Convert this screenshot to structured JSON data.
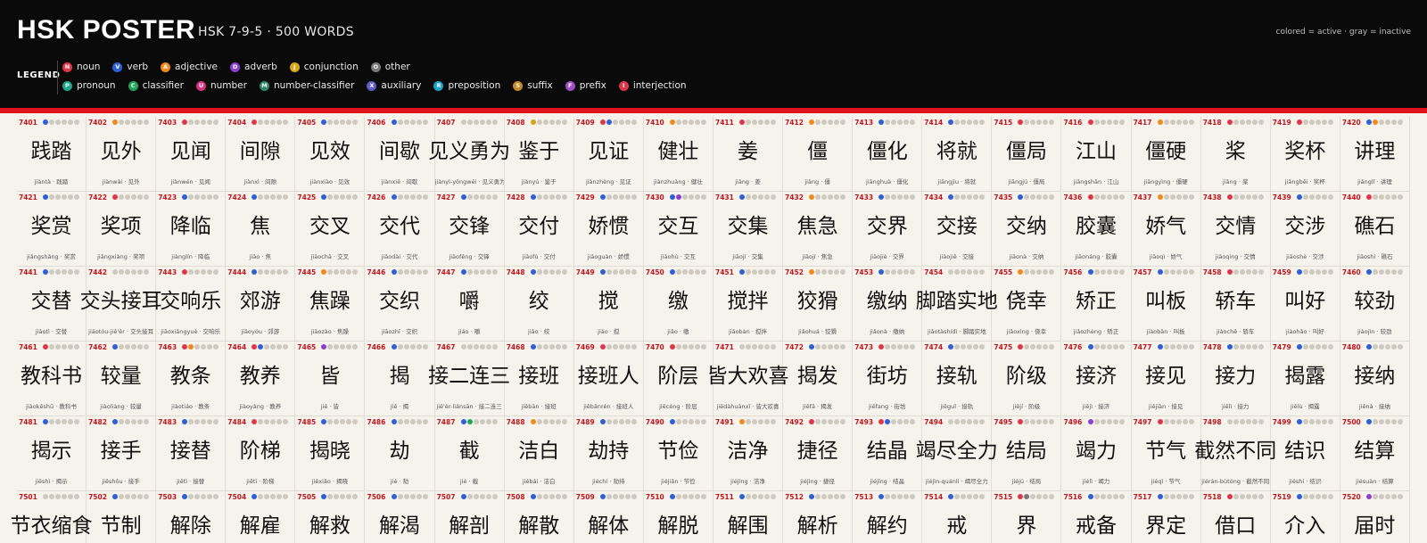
{
  "header": {
    "title": "HSK POSTER",
    "subtitle": "HSK 7-9-5  ·  500 WORDS",
    "hint": "colored = active   ·   gray = inactive",
    "legend_label": "LEGEND"
  },
  "legend": {
    "row1": [
      {
        "letter": "N",
        "label": "noun",
        "color": "#e0364a"
      },
      {
        "letter": "V",
        "label": "verb",
        "color": "#2f5fd6"
      },
      {
        "letter": "A",
        "label": "adjective",
        "color": "#f08a1c"
      },
      {
        "letter": "D",
        "label": "adverb",
        "color": "#8a3fd1"
      },
      {
        "letter": "J",
        "label": "conjunction",
        "color": "#d9a514"
      },
      {
        "letter": "O",
        "label": "other",
        "color": "#777777"
      }
    ],
    "row2": [
      {
        "letter": "P",
        "label": "pronoun",
        "color": "#1ea88a"
      },
      {
        "letter": "C",
        "label": "classifier",
        "color": "#22a45a"
      },
      {
        "letter": "U",
        "label": "number",
        "color": "#d6317e"
      },
      {
        "letter": "M",
        "label": "number-classifier",
        "color": "#2f8a6a"
      },
      {
        "letter": "X",
        "label": "auxiliary",
        "color": "#5b5fc7"
      },
      {
        "letter": "R",
        "label": "preposition",
        "color": "#1fa3c4"
      },
      {
        "letter": "S",
        "label": "suffix",
        "color": "#c48a2a"
      },
      {
        "letter": "F",
        "label": "prefix",
        "color": "#a04fc4"
      },
      {
        "letter": "I",
        "label": "interjection",
        "color": "#e0364a"
      }
    ]
  },
  "accent_color": "#e0141c",
  "cells": [
    {
      "num": "7401",
      "pos": "V",
      "word": "践踏",
      "py": "jiàntà"
    },
    {
      "num": "7402",
      "pos": "A",
      "word": "见外",
      "py": "jiànwài"
    },
    {
      "num": "7403",
      "pos": "N",
      "word": "见闻",
      "py": "jiànwén"
    },
    {
      "num": "7404",
      "pos": "N",
      "word": "间隙",
      "py": "jiànxì"
    },
    {
      "num": "7405",
      "pos": "V",
      "word": "见效",
      "py": "jiànxiào"
    },
    {
      "num": "7406",
      "pos": "V",
      "word": "间歇",
      "py": "jiànxiē"
    },
    {
      "num": "7407",
      "pos": "",
      "word": "见义勇为",
      "py": "jiànyì-yǒngwéi"
    },
    {
      "num": "7408",
      "pos": "J",
      "word": "鉴于",
      "py": "jiànyú"
    },
    {
      "num": "7409",
      "pos": "NV",
      "word": "见证",
      "py": "jiànzhèng"
    },
    {
      "num": "7410",
      "pos": "A",
      "word": "健壮",
      "py": "jiànzhuàng"
    },
    {
      "num": "7411",
      "pos": "N",
      "word": "姜",
      "py": "jiāng"
    },
    {
      "num": "7412",
      "pos": "A",
      "word": "僵",
      "py": "jiāng"
    },
    {
      "num": "7413",
      "pos": "V",
      "word": "僵化",
      "py": "jiānghuà"
    },
    {
      "num": "7414",
      "pos": "V",
      "word": "将就",
      "py": "jiāngjiu"
    },
    {
      "num": "7415",
      "pos": "N",
      "word": "僵局",
      "py": "jiāngjú"
    },
    {
      "num": "7416",
      "pos": "N",
      "word": "江山",
      "py": "jiāngshān"
    },
    {
      "num": "7417",
      "pos": "A",
      "word": "僵硬",
      "py": "jiāngyìng"
    },
    {
      "num": "7418",
      "pos": "N",
      "word": "桨",
      "py": "jiǎng"
    },
    {
      "num": "7419",
      "pos": "N",
      "word": "奖杯",
      "py": "jiǎngbēi"
    },
    {
      "num": "7420",
      "pos": "VA",
      "word": "讲理",
      "py": "jiǎnglǐ"
    },
    {
      "num": "7421",
      "pos": "V",
      "word": "奖赏",
      "py": "jiǎngshǎng"
    },
    {
      "num": "7422",
      "pos": "N",
      "word": "奖项",
      "py": "jiǎngxiàng"
    },
    {
      "num": "7423",
      "pos": "V",
      "word": "降临",
      "py": "jiànglín"
    },
    {
      "num": "7424",
      "pos": "V",
      "word": "焦",
      "py": "jiāo"
    },
    {
      "num": "7425",
      "pos": "V",
      "word": "交叉",
      "py": "jiāochā"
    },
    {
      "num": "7426",
      "pos": "V",
      "word": "交代",
      "py": "jiāodài"
    },
    {
      "num": "7427",
      "pos": "V",
      "word": "交锋",
      "py": "jiāofēng"
    },
    {
      "num": "7428",
      "pos": "V",
      "word": "交付",
      "py": "jiāofù"
    },
    {
      "num": "7429",
      "pos": "V",
      "word": "娇惯",
      "py": "jiāoguàn"
    },
    {
      "num": "7430",
      "pos": "VD",
      "word": "交互",
      "py": "jiāohù"
    },
    {
      "num": "7431",
      "pos": "V",
      "word": "交集",
      "py": "jiāojí"
    },
    {
      "num": "7432",
      "pos": "A",
      "word": "焦急",
      "py": "jiāojí"
    },
    {
      "num": "7433",
      "pos": "V",
      "word": "交界",
      "py": "jiāojiè"
    },
    {
      "num": "7434",
      "pos": "V",
      "word": "交接",
      "py": "jiāojiē"
    },
    {
      "num": "7435",
      "pos": "V",
      "word": "交纳",
      "py": "jiāonà"
    },
    {
      "num": "7436",
      "pos": "N",
      "word": "胶囊",
      "py": "jiāonáng"
    },
    {
      "num": "7437",
      "pos": "A",
      "word": "娇气",
      "py": "jiāoqì"
    },
    {
      "num": "7438",
      "pos": "N",
      "word": "交情",
      "py": "jiāoqing"
    },
    {
      "num": "7439",
      "pos": "V",
      "word": "交涉",
      "py": "jiāoshè"
    },
    {
      "num": "7440",
      "pos": "N",
      "word": "礁石",
      "py": "jiāoshí"
    },
    {
      "num": "7441",
      "pos": "V",
      "word": "交替",
      "py": "jiāotì"
    },
    {
      "num": "7442",
      "pos": "",
      "word": "交头接耳",
      "py": "jiāotóu-jiē'ěr"
    },
    {
      "num": "7443",
      "pos": "N",
      "word": "交响乐",
      "py": "jiāoxiǎngyuè"
    },
    {
      "num": "7444",
      "pos": "V",
      "word": "郊游",
      "py": "jiāoyóu"
    },
    {
      "num": "7445",
      "pos": "A",
      "word": "焦躁",
      "py": "jiāozào"
    },
    {
      "num": "7446",
      "pos": "V",
      "word": "交织",
      "py": "jiāozhī"
    },
    {
      "num": "7447",
      "pos": "V",
      "word": "嚼",
      "py": "jiáo"
    },
    {
      "num": "7448",
      "pos": "V",
      "word": "绞",
      "py": "jiǎo"
    },
    {
      "num": "7449",
      "pos": "V",
      "word": "搅",
      "py": "jiǎo"
    },
    {
      "num": "7450",
      "pos": "V",
      "word": "缴",
      "py": "jiǎo"
    },
    {
      "num": "7451",
      "pos": "V",
      "word": "搅拌",
      "py": "jiǎobàn"
    },
    {
      "num": "7452",
      "pos": "A",
      "word": "狡猾",
      "py": "jiǎohuá"
    },
    {
      "num": "7453",
      "pos": "V",
      "word": "缴纳",
      "py": "jiǎonà"
    },
    {
      "num": "7454",
      "pos": "",
      "word": "脚踏实地",
      "py": "jiǎotàshídì"
    },
    {
      "num": "7455",
      "pos": "A",
      "word": "侥幸",
      "py": "jiǎoxìng"
    },
    {
      "num": "7456",
      "pos": "V",
      "word": "矫正",
      "py": "jiǎozhèng"
    },
    {
      "num": "7457",
      "pos": "V",
      "word": "叫板",
      "py": "jiàobǎn"
    },
    {
      "num": "7458",
      "pos": "N",
      "word": "轿车",
      "py": "jiàochē"
    },
    {
      "num": "7459",
      "pos": "V",
      "word": "叫好",
      "py": "jiàohǎo"
    },
    {
      "num": "7460",
      "pos": "V",
      "word": "较劲",
      "py": "jiàojìn"
    },
    {
      "num": "7461",
      "pos": "N",
      "word": "教科书",
      "py": "jiàokēshū"
    },
    {
      "num": "7462",
      "pos": "V",
      "word": "较量",
      "py": "jiàoliàng"
    },
    {
      "num": "7463",
      "pos": "NA",
      "word": "教条",
      "py": "jiàotiáo"
    },
    {
      "num": "7464",
      "pos": "NV",
      "word": "教养",
      "py": "jiàoyǎng"
    },
    {
      "num": "7465",
      "pos": "D",
      "word": "皆",
      "py": "jiē"
    },
    {
      "num": "7466",
      "pos": "V",
      "word": "揭",
      "py": "jiē"
    },
    {
      "num": "7467",
      "pos": "",
      "word": "接二连三",
      "py": "jiē'èr-liánsān"
    },
    {
      "num": "7468",
      "pos": "V",
      "word": "接班",
      "py": "jiēbān"
    },
    {
      "num": "7469",
      "pos": "N",
      "word": "接班人",
      "py": "jiēbānrén"
    },
    {
      "num": "7470",
      "pos": "N",
      "word": "阶层",
      "py": "jiēcéng"
    },
    {
      "num": "7471",
      "pos": "",
      "word": "皆大欢喜",
      "py": "jiēdàhuānxǐ"
    },
    {
      "num": "7472",
      "pos": "V",
      "word": "揭发",
      "py": "jiēfā"
    },
    {
      "num": "7473",
      "pos": "N",
      "word": "街坊",
      "py": "jiēfang"
    },
    {
      "num": "7474",
      "pos": "V",
      "word": "接轨",
      "py": "jiēguǐ"
    },
    {
      "num": "7475",
      "pos": "N",
      "word": "阶级",
      "py": "jiējí"
    },
    {
      "num": "7476",
      "pos": "V",
      "word": "接济",
      "py": "jiējì"
    },
    {
      "num": "7477",
      "pos": "V",
      "word": "接见",
      "py": "jiējiàn"
    },
    {
      "num": "7478",
      "pos": "V",
      "word": "接力",
      "py": "jiēlì"
    },
    {
      "num": "7479",
      "pos": "V",
      "word": "揭露",
      "py": "jiēlù"
    },
    {
      "num": "7480",
      "pos": "V",
      "word": "接纳",
      "py": "jiēnà"
    },
    {
      "num": "7481",
      "pos": "V",
      "word": "揭示",
      "py": "jiēshì"
    },
    {
      "num": "7482",
      "pos": "V",
      "word": "接手",
      "py": "jiēshǒu"
    },
    {
      "num": "7483",
      "pos": "V",
      "word": "接替",
      "py": "jiētì"
    },
    {
      "num": "7484",
      "pos": "N",
      "word": "阶梯",
      "py": "jiētī"
    },
    {
      "num": "7485",
      "pos": "V",
      "word": "揭晓",
      "py": "jiēxiǎo"
    },
    {
      "num": "7486",
      "pos": "V",
      "word": "劫",
      "py": "jié"
    },
    {
      "num": "7487",
      "pos": "VC",
      "word": "截",
      "py": "jié"
    },
    {
      "num": "7488",
      "pos": "A",
      "word": "洁白",
      "py": "jiébái"
    },
    {
      "num": "7489",
      "pos": "V",
      "word": "劫持",
      "py": "jiéchí"
    },
    {
      "num": "7490",
      "pos": "V",
      "word": "节俭",
      "py": "jiéjiǎn"
    },
    {
      "num": "7491",
      "pos": "A",
      "word": "洁净",
      "py": "jiéjìng"
    },
    {
      "num": "7492",
      "pos": "N",
      "word": "捷径",
      "py": "jiéjìng"
    },
    {
      "num": "7493",
      "pos": "NV",
      "word": "结晶",
      "py": "jiéjīng"
    },
    {
      "num": "7494",
      "pos": "",
      "word": "竭尽全力",
      "py": "jiéjìn-quánlì"
    },
    {
      "num": "7495",
      "pos": "N",
      "word": "结局",
      "py": "jiéjú"
    },
    {
      "num": "7496",
      "pos": "D",
      "word": "竭力",
      "py": "jiélì"
    },
    {
      "num": "7497",
      "pos": "N",
      "word": "节气",
      "py": "jiéqì"
    },
    {
      "num": "7498",
      "pos": "",
      "word": "截然不同",
      "py": "jiérán-bùtóng"
    },
    {
      "num": "7499",
      "pos": "V",
      "word": "结识",
      "py": "jiéshí"
    },
    {
      "num": "7500",
      "pos": "V",
      "word": "结算",
      "py": "jiésuàn"
    },
    {
      "num": "7501",
      "pos": "",
      "word": "节衣缩食",
      "py": ""
    },
    {
      "num": "7502",
      "pos": "V",
      "word": "节制",
      "py": ""
    },
    {
      "num": "7503",
      "pos": "V",
      "word": "解除",
      "py": ""
    },
    {
      "num": "7504",
      "pos": "V",
      "word": "解雇",
      "py": ""
    },
    {
      "num": "7505",
      "pos": "V",
      "word": "解救",
      "py": ""
    },
    {
      "num": "7506",
      "pos": "V",
      "word": "解渴",
      "py": ""
    },
    {
      "num": "7507",
      "pos": "V",
      "word": "解剖",
      "py": ""
    },
    {
      "num": "7508",
      "pos": "V",
      "word": "解散",
      "py": ""
    },
    {
      "num": "7509",
      "pos": "V",
      "word": "解体",
      "py": ""
    },
    {
      "num": "7510",
      "pos": "V",
      "word": "解脱",
      "py": ""
    },
    {
      "num": "7511",
      "pos": "V",
      "word": "解围",
      "py": ""
    },
    {
      "num": "7512",
      "pos": "V",
      "word": "解析",
      "py": ""
    },
    {
      "num": "7513",
      "pos": "V",
      "word": "解约",
      "py": ""
    },
    {
      "num": "7514",
      "pos": "V",
      "word": "戒",
      "py": ""
    },
    {
      "num": "7515",
      "pos": "NO",
      "word": "界",
      "py": ""
    },
    {
      "num": "7516",
      "pos": "V",
      "word": "戒备",
      "py": ""
    },
    {
      "num": "7517",
      "pos": "V",
      "word": "界定",
      "py": ""
    },
    {
      "num": "7518",
      "pos": "N",
      "word": "借口",
      "py": ""
    },
    {
      "num": "7519",
      "pos": "V",
      "word": "介入",
      "py": ""
    },
    {
      "num": "7520",
      "pos": "D",
      "word": "届时",
      "py": ""
    }
  ]
}
